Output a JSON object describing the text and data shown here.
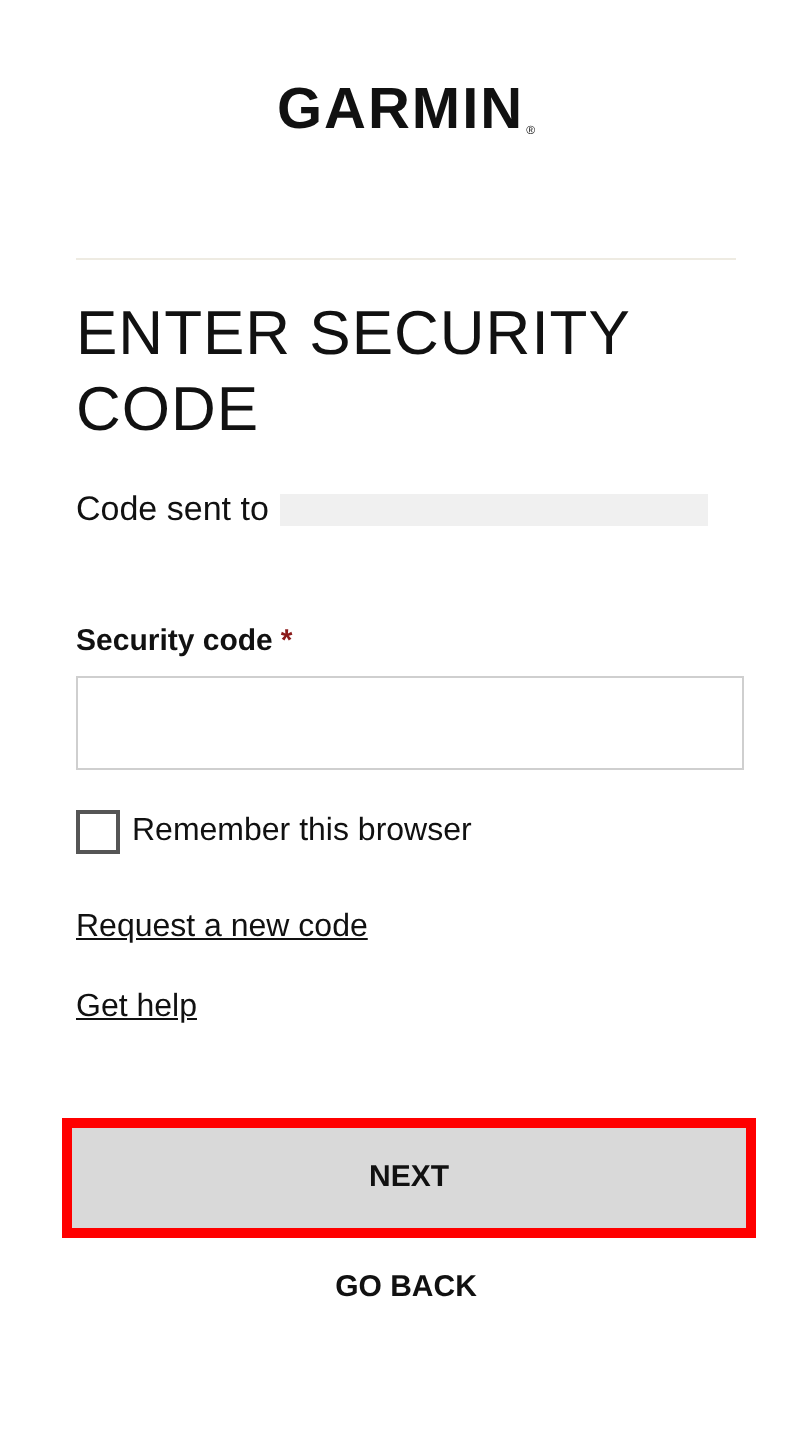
{
  "logo": {
    "text": "GARMIN",
    "mark": "®"
  },
  "title": "ENTER SECURITY CODE",
  "code_sent": {
    "label": "Code sent to",
    "recipient_hidden": true
  },
  "security_code": {
    "label": "Security code",
    "required": true,
    "required_mark": "*"
  },
  "remember": {
    "label": "Remember this browser",
    "checked": false
  },
  "links": [
    {
      "text": "Request a new code"
    },
    {
      "text": "Get help"
    }
  ],
  "next_button": {
    "label": "NEXT",
    "highlighted": true
  },
  "back_button": {
    "label": "GO BACK"
  }
}
